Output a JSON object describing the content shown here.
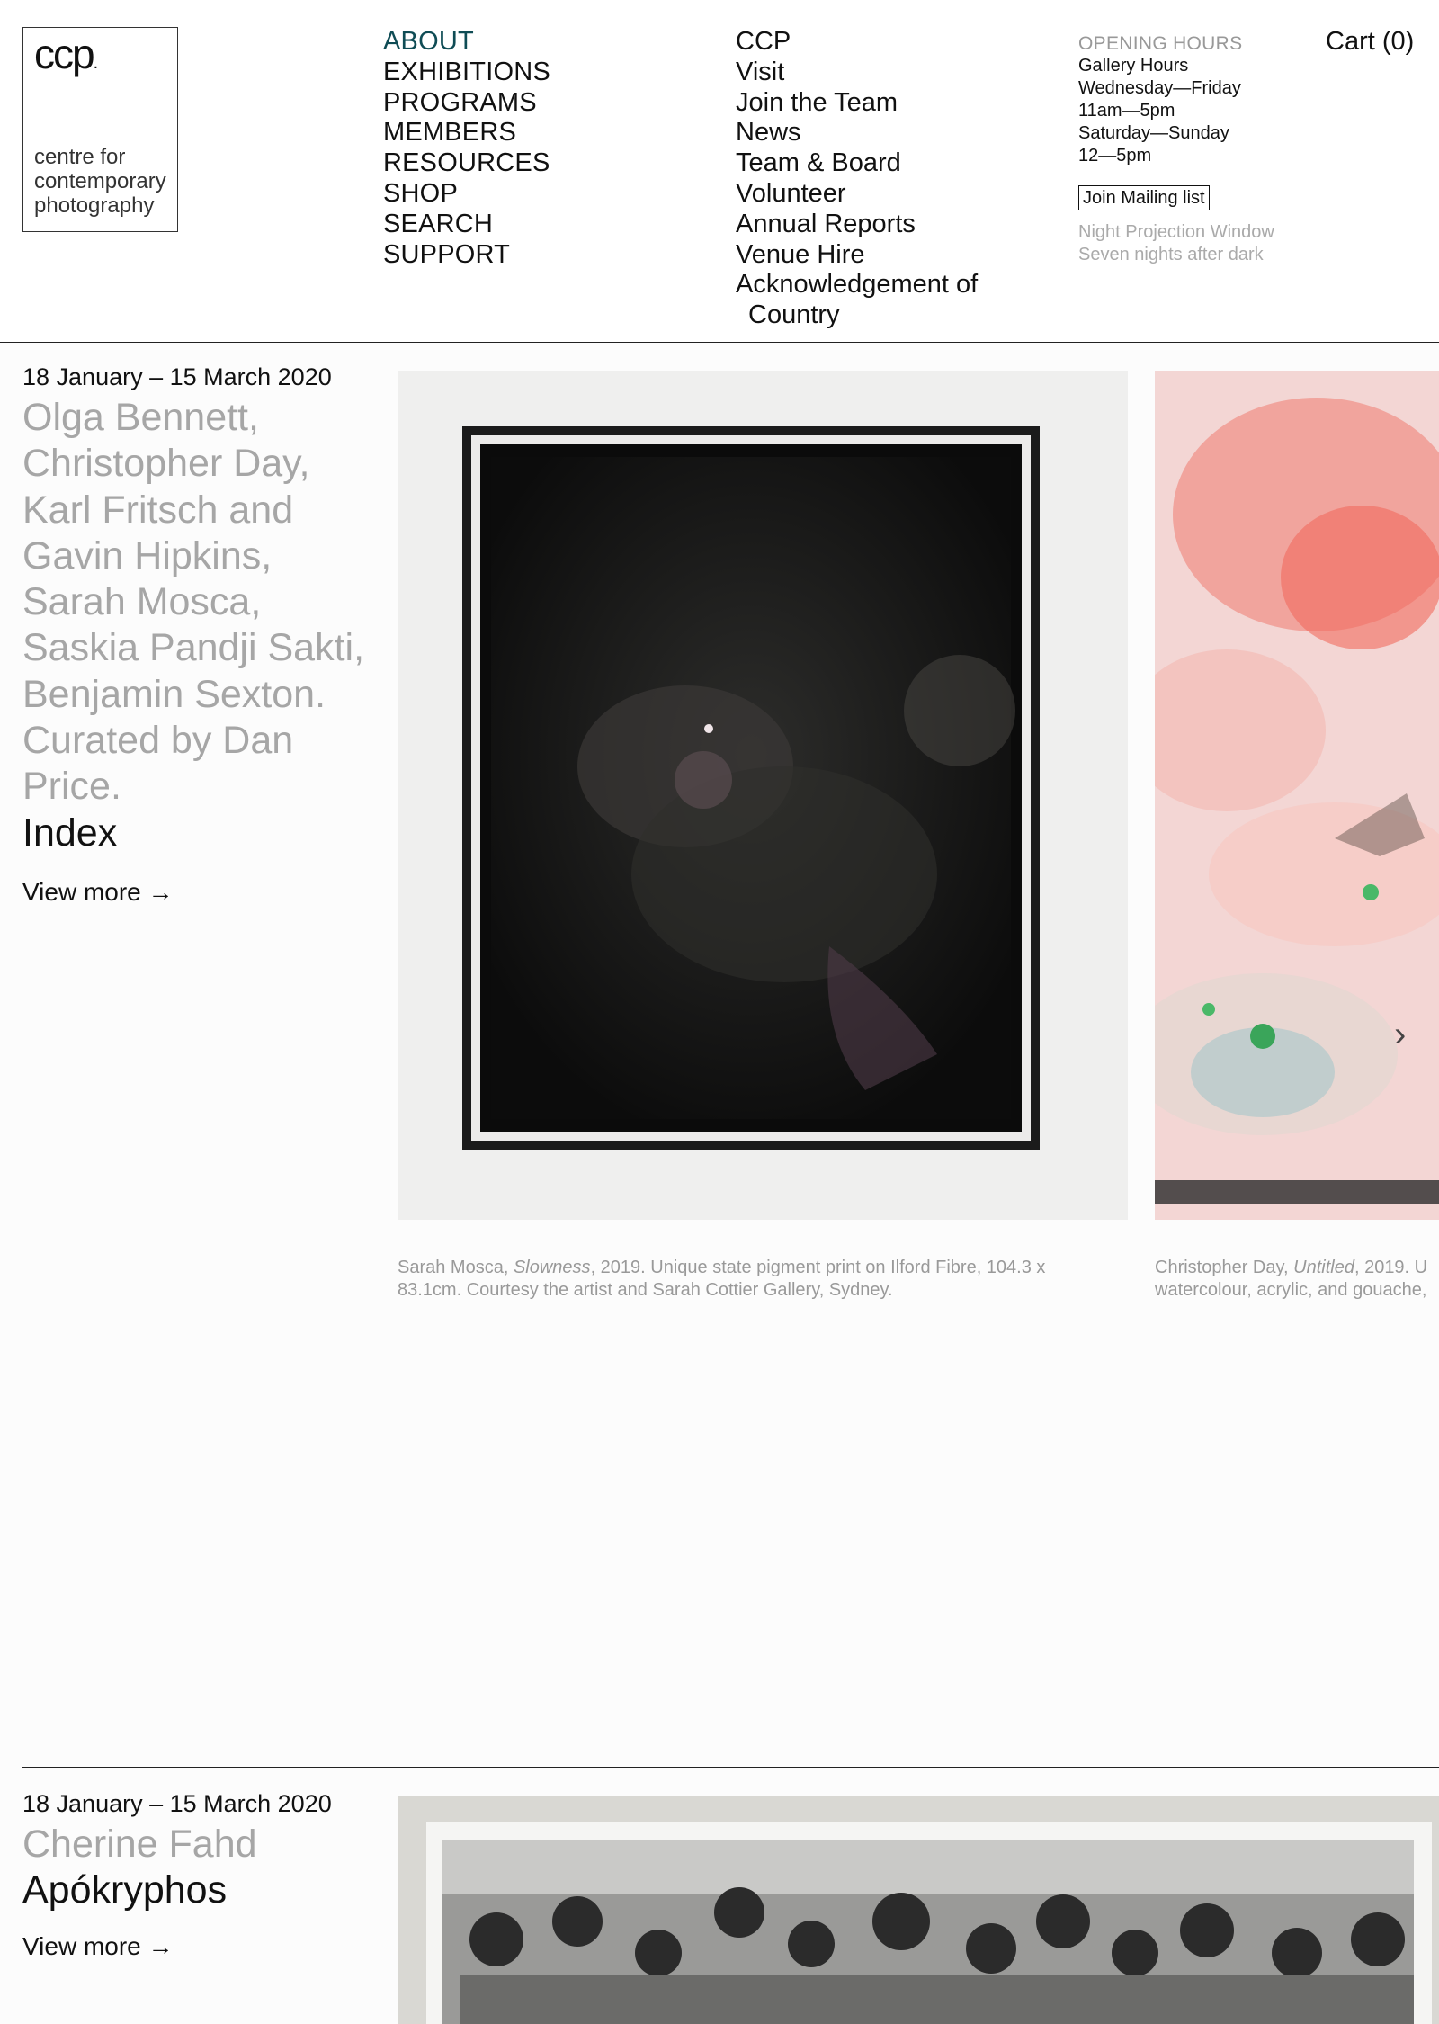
{
  "logo": {
    "mark": "ccp",
    "dot": ".",
    "subtitle": "centre for contemporary photography"
  },
  "nav_main": [
    "ABOUT",
    "EXHIBITIONS",
    "PROGRAMS",
    "MEMBERS",
    "RESOURCES",
    "SHOP",
    "SEARCH",
    "SUPPORT"
  ],
  "nav_sub": [
    "CCP",
    "Visit",
    "Join the Team",
    "News",
    "Team & Board",
    "Volunteer",
    "Annual Reports",
    "Venue Hire",
    "Acknowledgement of",
    "Country"
  ],
  "hours": {
    "label": "OPENING HOURS",
    "lines": [
      "Gallery Hours",
      "Wednesday—Friday",
      "11am—5pm",
      "Saturday—Sunday",
      "12—5pm"
    ],
    "mailing": "Join Mailing list",
    "night": [
      "Night Projection Window",
      "Seven nights after dark"
    ]
  },
  "cart": "Cart (0)",
  "exhibitions": [
    {
      "date": "18 January – 15 March 2020",
      "artists": "Olga Bennett, Christopher Day, Karl Fritsch and Gavin Hipkins, Sarah Mosca, Saskia Pandji Sakti, Benjamin Sexton. Curated by Dan Price.",
      "title": "Index",
      "view_more": "View more →",
      "captions": [
        {
          "artist": "Sarah Mosca, ",
          "work": "Slowness",
          "rest": ", 2019. Unique state pigment print on Ilford Fibre, 104.3 x 83.1cm. Courtesy the artist and Sarah Cottier Gallery, Sydney."
        },
        {
          "artist": "Christopher Day, ",
          "work": "Untitled",
          "rest": ", 2019. U",
          "line2": "watercolour, acrylic, and gouache,"
        }
      ],
      "next_arrow": "›"
    },
    {
      "date": "18 January – 15 March 2020",
      "artists": "Cherine Fahd",
      "title": "Apókryphos",
      "view_more": "View more →"
    }
  ]
}
